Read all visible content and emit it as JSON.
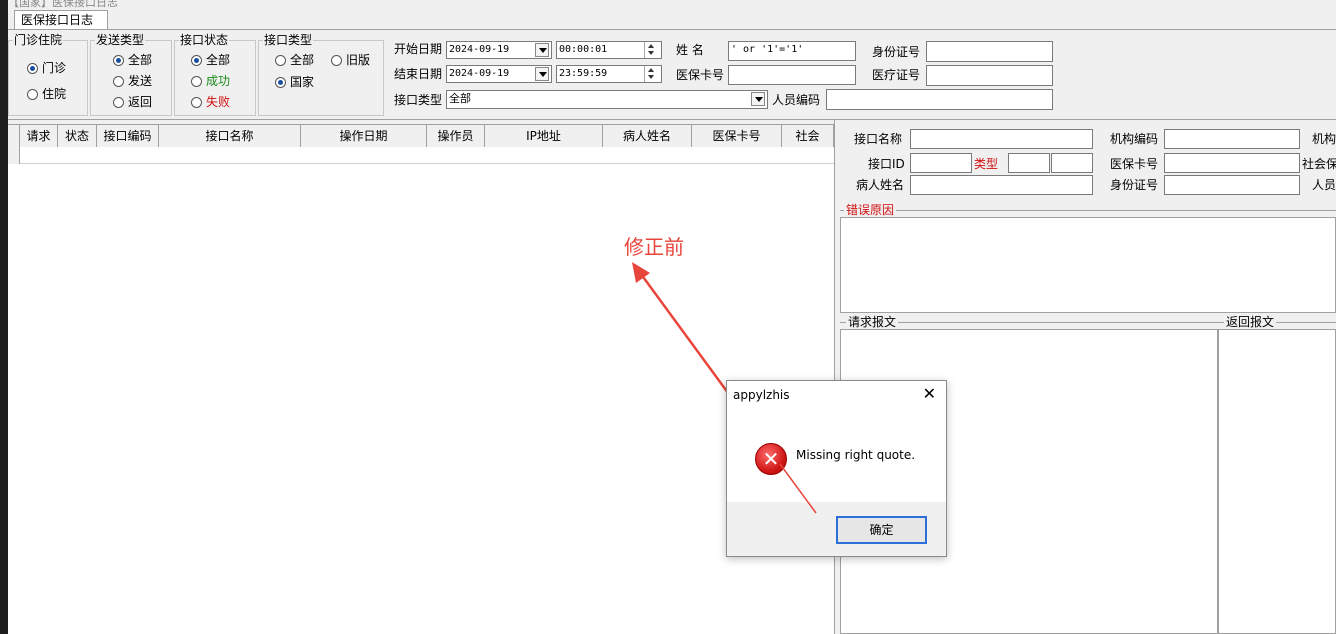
{
  "window_title": "【国家】医保接口日志",
  "tab_label": "医保接口日志",
  "filters": {
    "visit": {
      "title": "门诊住院",
      "options": [
        "门诊",
        "住院"
      ],
      "selected": 0
    },
    "send_type": {
      "title": "发送类型",
      "options": [
        "全部",
        "发送",
        "返回"
      ],
      "selected": 0
    },
    "status": {
      "title": "接口状态",
      "options": [
        "全部",
        "成功",
        "失败"
      ],
      "selected": 0
    },
    "iface_kind": {
      "title": "接口类型",
      "options": [
        "全部",
        "旧版",
        "国家"
      ],
      "selected": 2
    },
    "start_date_label": "开始日期",
    "start_date": "2024-09-19",
    "start_time": "00:00:01",
    "end_date_label": "结束日期",
    "end_date": "2024-09-19",
    "end_time": "23:59:59",
    "name_label": "姓  名",
    "name_value": "' or '1'='1'",
    "card_label": "医保卡号",
    "card_value": "",
    "idcard_label": "身份证号",
    "idcard_value": "",
    "medcard_label": "医疗证号",
    "medcard_value": "",
    "iface_type_label": "接口类型",
    "iface_type_value": "全部",
    "staff_label": "人员编码",
    "staff_value": ""
  },
  "table": {
    "columns": [
      "请求",
      "状态",
      "接口编码",
      "接口名称",
      "操作日期",
      "操作员",
      "IP地址",
      "病人姓名",
      "医保卡号",
      "社会"
    ]
  },
  "detail": {
    "iface_name_label": "接口名称",
    "org_code_label": "机构编码",
    "org_label": "机构",
    "iface_id_label": "接口ID",
    "type_label": "类型",
    "card_label": "医保卡号",
    "social_label": "社会保",
    "patient_label": "病人姓名",
    "idcard_label": "身份证号",
    "person_label": "人员",
    "error_title": "错误原因",
    "request_title": "请求报文",
    "response_title": "返回报文"
  },
  "annotation": {
    "text": "修正前",
    "color": "#e8463c"
  },
  "dialog": {
    "title": "appylzhis",
    "message": "Missing right quote.",
    "ok_label": "确定",
    "close_glyph": "✕",
    "icon": "error-icon"
  }
}
